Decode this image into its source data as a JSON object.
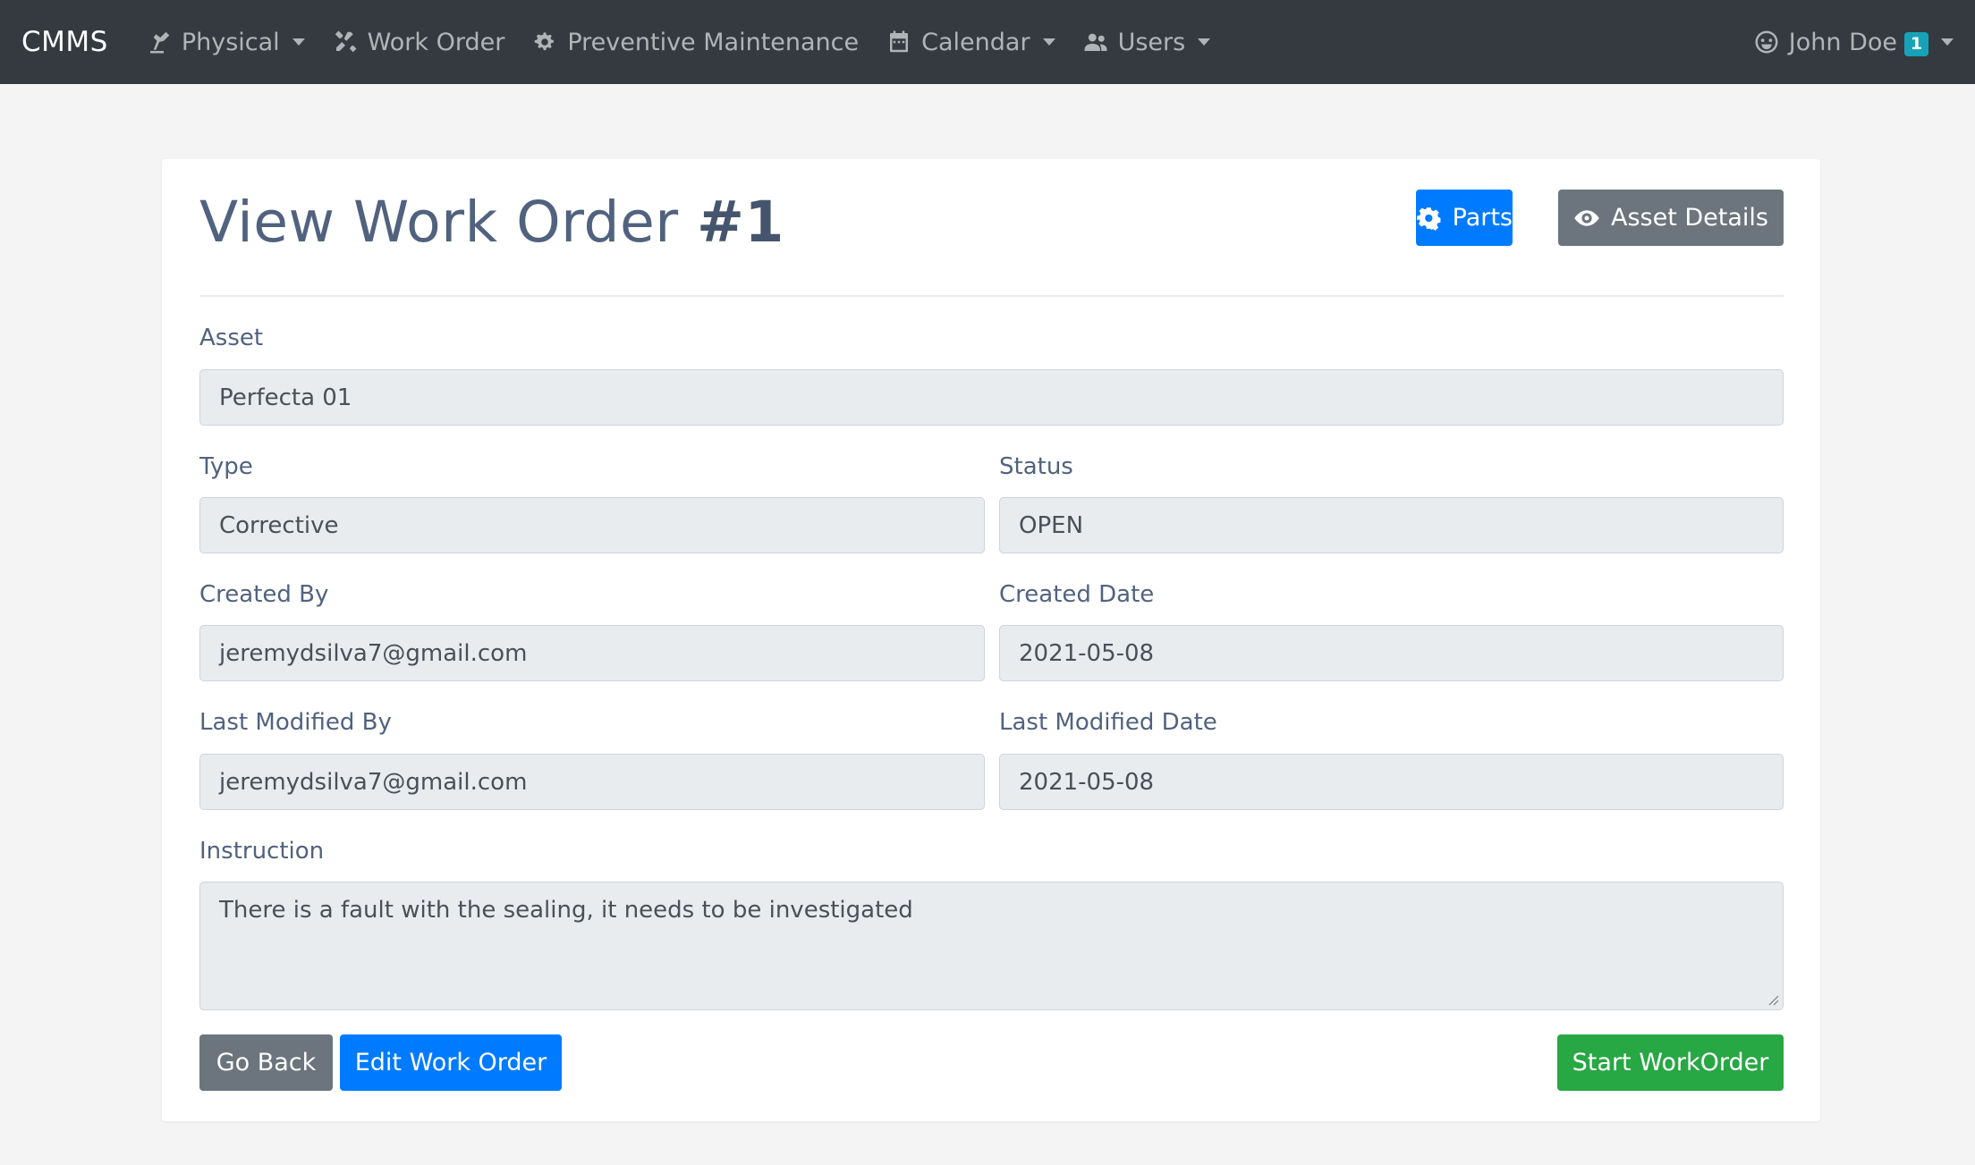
{
  "nav": {
    "brand": "CMMS",
    "items": [
      {
        "label": "Physical",
        "icon": "robot-arm-icon"
      },
      {
        "label": "Work Order",
        "icon": "tools-icon"
      },
      {
        "label": "Preventive Maintenance",
        "icon": "cogs-icon"
      },
      {
        "label": "Calendar",
        "icon": "calendar-icon"
      },
      {
        "label": "Users",
        "icon": "users-icon"
      }
    ],
    "user": {
      "name": "John Doe",
      "notifications": "1",
      "icon": "smiley-face-icon"
    }
  },
  "page": {
    "title_prefix": "View Work Order ",
    "title_number": "#1",
    "parts_label": "Parts",
    "asset_details_label": "Asset Details"
  },
  "form": {
    "asset": {
      "label": "Asset",
      "value": "Perfecta 01"
    },
    "type": {
      "label": "Type",
      "value": "Corrective"
    },
    "status": {
      "label": "Status",
      "value": "OPEN"
    },
    "created_by": {
      "label": "Created By",
      "value": "jeremydsilva7@gmail.com"
    },
    "created_date": {
      "label": "Created Date",
      "value": "2021-05-08"
    },
    "last_modified_by": {
      "label": "Last Modified By",
      "value": "jeremydsilva7@gmail.com"
    },
    "last_modified_date": {
      "label": "Last Modified Date",
      "value": "2021-05-08"
    },
    "instruction": {
      "label": "Instruction",
      "value": "There is a fault with the sealing, it needs to be investigated"
    }
  },
  "actions": {
    "go_back": "Go Back",
    "edit": "Edit Work Order",
    "start": "Start WorkOrder"
  },
  "colors": {
    "navbar": "#343a40",
    "primary": "#007bff",
    "secondary": "#6c757d",
    "success": "#28a745",
    "badge": "#17a2b8"
  }
}
